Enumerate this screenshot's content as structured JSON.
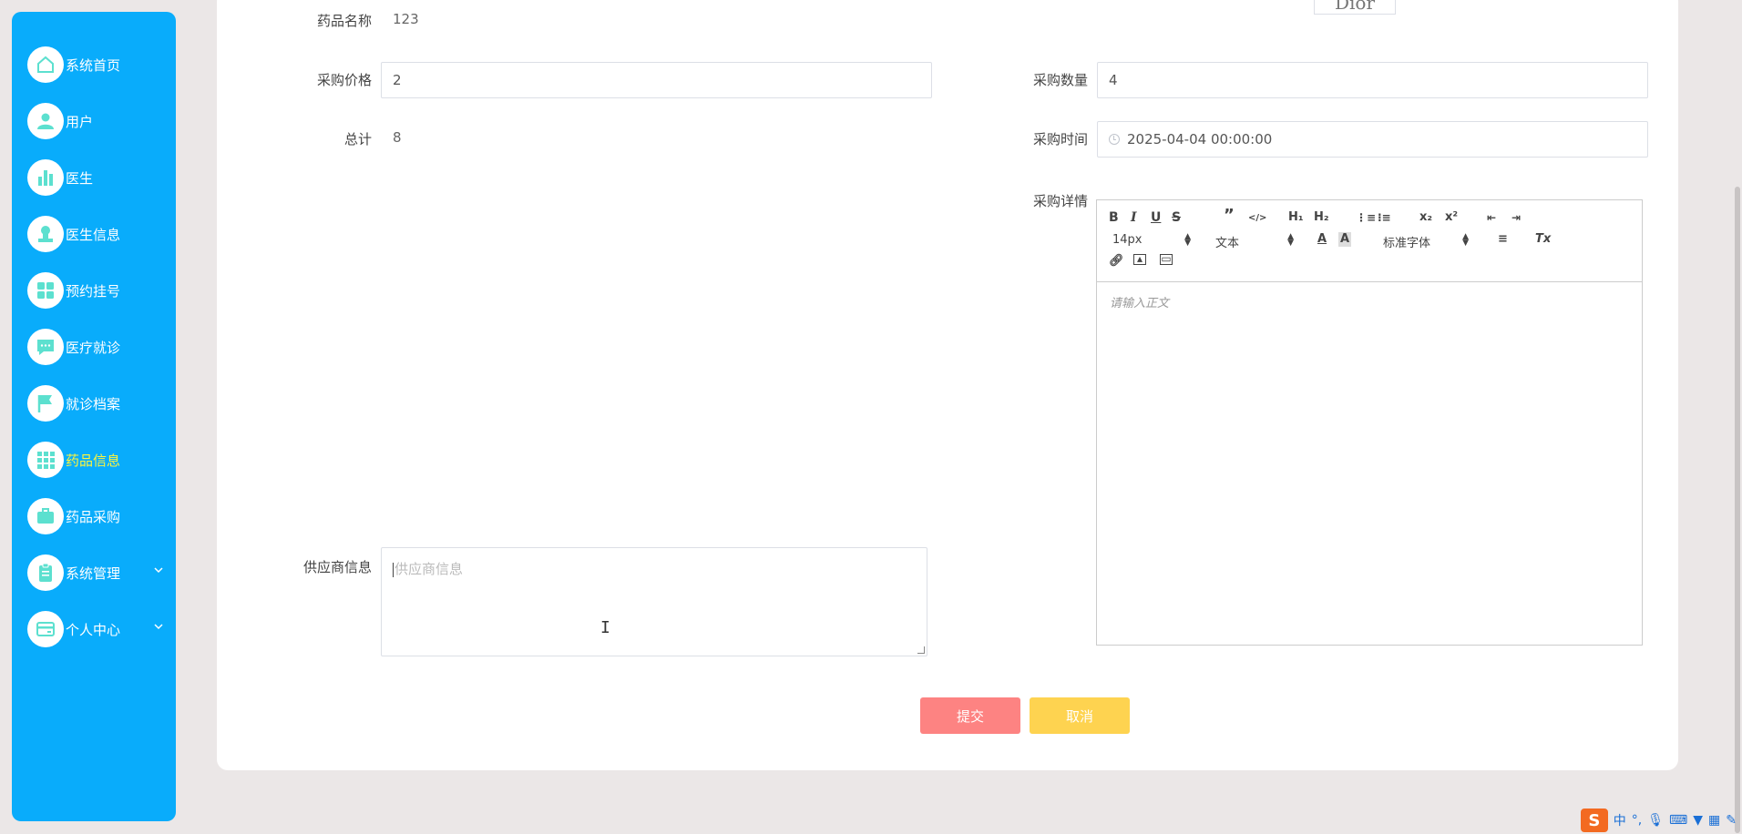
{
  "sidebar": {
    "items": [
      {
        "label": "系统首页",
        "icon": "home-icon"
      },
      {
        "label": "用户",
        "icon": "user-icon"
      },
      {
        "label": "医生",
        "icon": "bar-chart-icon"
      },
      {
        "label": "医生信息",
        "icon": "stamp-icon"
      },
      {
        "label": "预约挂号",
        "icon": "grid-icon"
      },
      {
        "label": "医疗就诊",
        "icon": "chat-icon"
      },
      {
        "label": "就诊档案",
        "icon": "flag-icon"
      },
      {
        "label": "药品信息",
        "icon": "apps-icon",
        "active": true
      },
      {
        "label": "药品采购",
        "icon": "briefcase-icon"
      },
      {
        "label": "系统管理",
        "icon": "clipboard-icon",
        "expandable": true
      },
      {
        "label": "个人中心",
        "icon": "wallet-icon",
        "expandable": true
      }
    ]
  },
  "form": {
    "drug_name_label": "药品名称",
    "drug_name_value": "123",
    "image_text": "Dior",
    "price_label": "采购价格",
    "price_value": "2",
    "quantity_label": "采购数量",
    "quantity_value": "4",
    "total_label": "总计",
    "total_value": "8",
    "time_label": "采购时间",
    "time_value": "2025-04-04 00:00:00",
    "detail_label": "采购详情",
    "supplier_label": "供应商信息",
    "supplier_placeholder": "供应商信息"
  },
  "editor": {
    "font_size": "14px",
    "text_type": "文本",
    "font_family": "标准字体",
    "placeholder": "请输入正文"
  },
  "buttons": {
    "submit": "提交",
    "cancel": "取消"
  },
  "ime": {
    "lang": "中",
    "punct": "°,"
  },
  "colors": {
    "sidebar_bg": "#09acfb",
    "active_text": "#fdf53d",
    "icon_color": "#5ce0cf",
    "submit_bg": "#fd8382",
    "cancel_bg": "#fed350"
  }
}
